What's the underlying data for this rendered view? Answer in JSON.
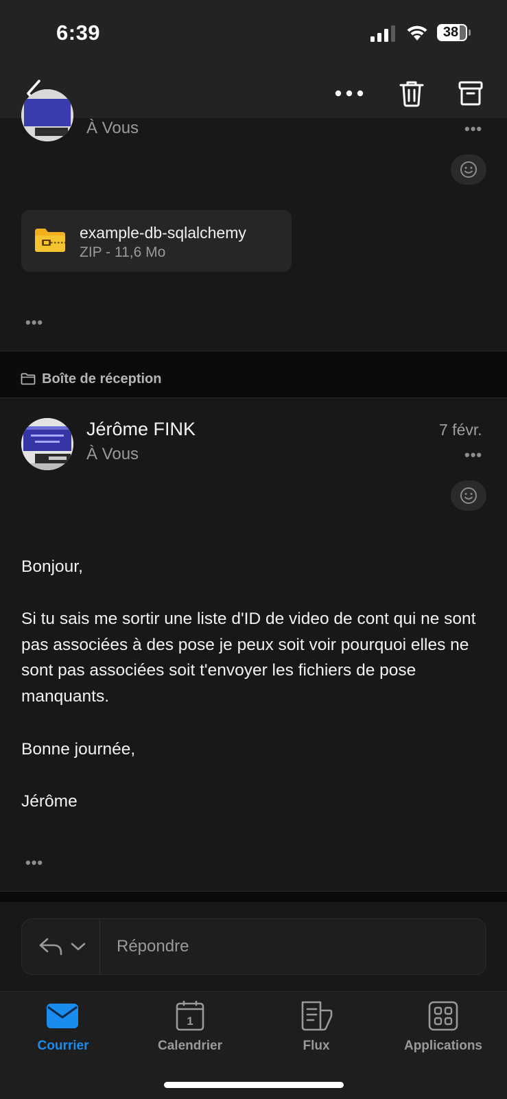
{
  "status": {
    "time": "6:39",
    "battery": "38"
  },
  "nav": {
    "back_icon": "chevron-left-icon",
    "more_icon": "more-horizontal-icon",
    "delete_icon": "trash-icon",
    "archive_icon": "archive-icon"
  },
  "first_message": {
    "recipient": "À Vous",
    "attachment": {
      "name": "example-db-sqlalchemy",
      "meta": "ZIP - 11,6 Mo"
    },
    "expand": "•••",
    "more": "•••"
  },
  "folder": {
    "label": "Boîte de réception"
  },
  "second_message": {
    "sender": "Jérôme FINK",
    "recipient": "À Vous",
    "date": "7 févr.",
    "more": "•••",
    "body": {
      "greeting": "Bonjour,",
      "paragraph": "Si tu sais me sortir une liste d'ID de video de cont qui ne sont pas associées à des pose je peux soit voir pourquoi elles ne sont pas associées soit t'envoyer les fichiers de pose manquants.",
      "closing": "Bonne journée,",
      "signature": "Jérôme"
    },
    "expand": "•••"
  },
  "reply": {
    "placeholder": "Répondre"
  },
  "tabs": [
    {
      "label": "Courrier",
      "active": true
    },
    {
      "label": "Calendrier",
      "active": false,
      "badge": "1"
    },
    {
      "label": "Flux",
      "active": false
    },
    {
      "label": "Applications",
      "active": false
    }
  ],
  "colors": {
    "accent": "#1a8cf0",
    "background": "#0b0b0b",
    "panel": "#181818"
  }
}
